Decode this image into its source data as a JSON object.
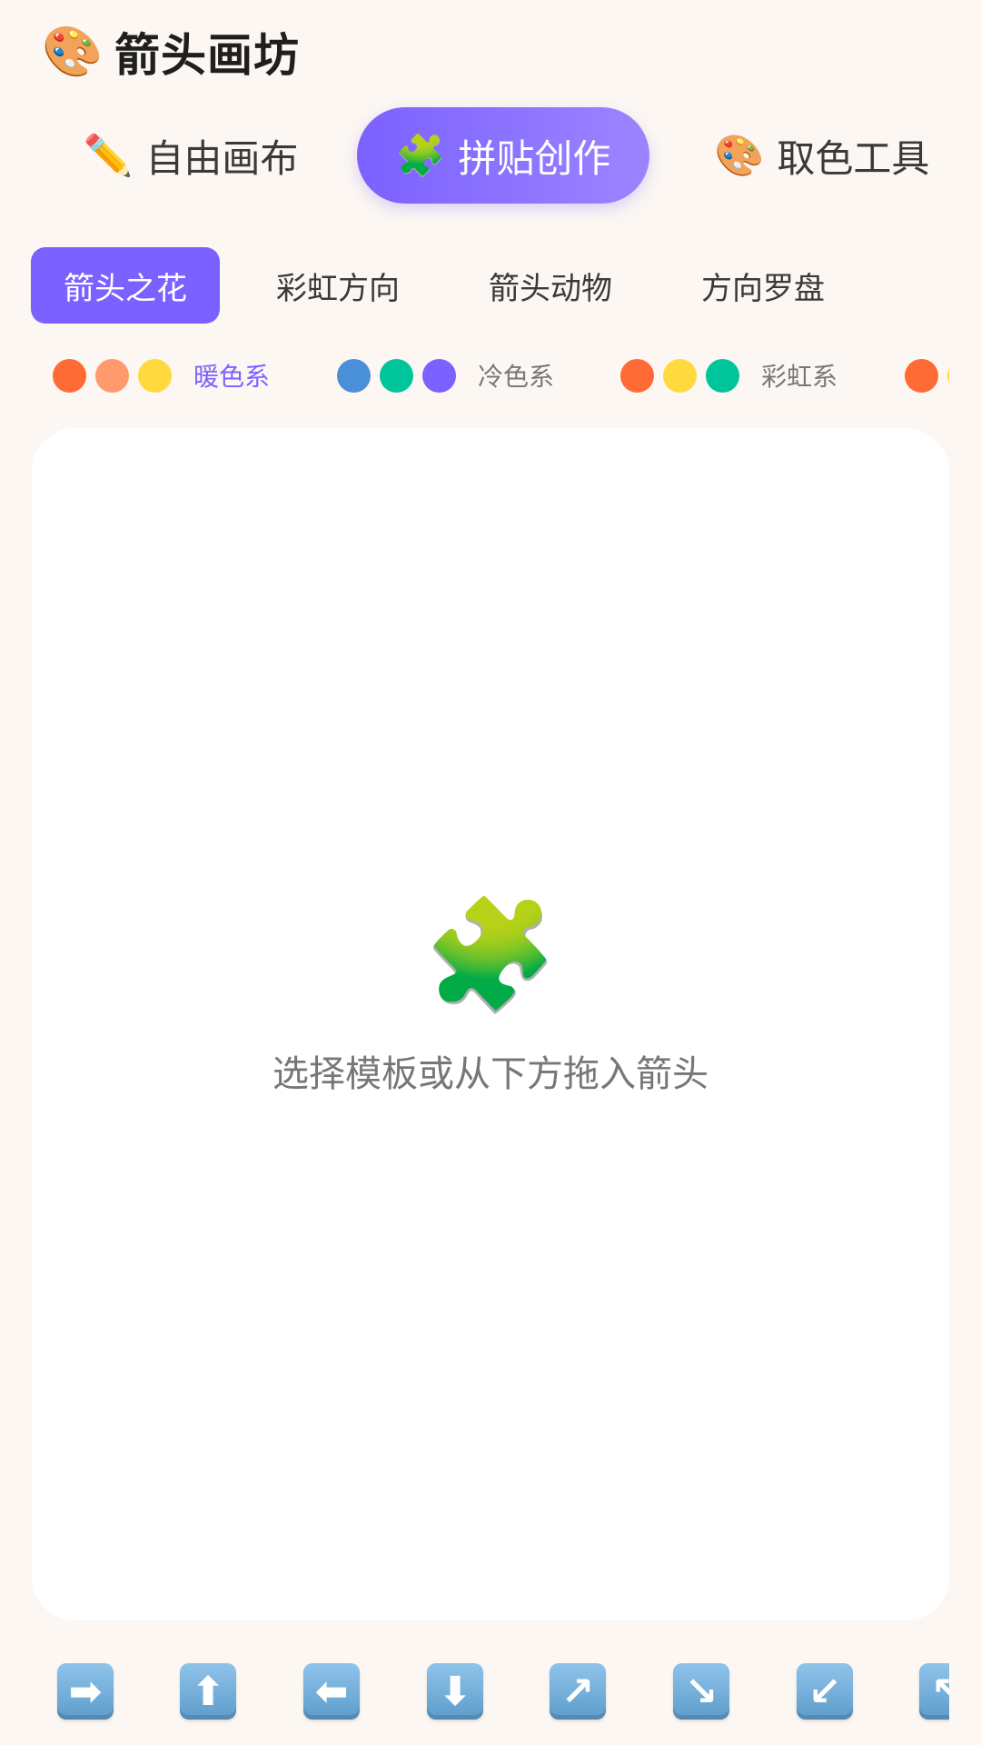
{
  "header": {
    "icon": "🎨",
    "icon_name": "palette-icon",
    "title": "箭头画坊"
  },
  "mode_tabs": [
    {
      "icon": "✏️",
      "label": "自由画布",
      "active": false
    },
    {
      "icon": "🧩",
      "label": "拼贴创作",
      "active": true
    },
    {
      "icon": "🎨",
      "label": "取色工具",
      "active": false
    }
  ],
  "templates": [
    {
      "label": "箭头之花",
      "active": true
    },
    {
      "label": "彩虹方向",
      "active": false
    },
    {
      "label": "箭头动物",
      "active": false
    },
    {
      "label": "方向罗盘",
      "active": false
    }
  ],
  "palettes": [
    {
      "label": "暖色系",
      "colors": [
        "#FF6B35",
        "#FF9A6C",
        "#FFD93D"
      ],
      "active": true
    },
    {
      "label": "冷色系",
      "colors": [
        "#4A90D9",
        "#00C49A",
        "#7B61FF"
      ],
      "active": false
    },
    {
      "label": "彩虹系",
      "colors": [
        "#FF6B35",
        "#FFD93D",
        "#00C49A"
      ],
      "active": false
    },
    {
      "label": "",
      "colors": [
        "#FF6B35",
        "#FFD93D"
      ],
      "active": false
    }
  ],
  "canvas": {
    "empty_icon": "🧩",
    "empty_text": "选择模板或从下方拖入箭头"
  },
  "arrows": [
    "➡",
    "⬆",
    "⬅",
    "⬇",
    "↗",
    "↘",
    "↙",
    "↖"
  ],
  "arrow_names": [
    "right",
    "up",
    "left",
    "down",
    "up-right",
    "down-right",
    "down-left",
    "up-left"
  ],
  "accent": "#7B61FF"
}
